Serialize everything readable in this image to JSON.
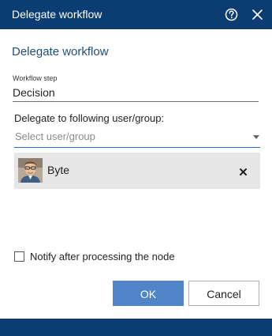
{
  "window": {
    "title": "Delegate workflow",
    "help_icon": "help-circle-icon",
    "close_icon": "close-icon"
  },
  "form": {
    "heading": "Delegate workflow",
    "workflow_step_label": "Workflow step",
    "workflow_step_value": "Decision",
    "delegate_label": "Delegate to following user/group:",
    "select_placeholder": "Select user/group",
    "selected_users": [
      {
        "name": "Byte",
        "avatar_icon": "user-avatar",
        "remove_icon": "remove-x-icon"
      }
    ],
    "notify_label": "Notify after processing the node",
    "notify_checked": false
  },
  "buttons": {
    "ok_label": "OK",
    "cancel_label": "Cancel"
  },
  "colors": {
    "titlebar": "#0c3d72",
    "heading": "#1f4e79",
    "primary_button": "#4f85c8",
    "chip_background": "#e6e6e6",
    "select_underline": "#2a6ac0"
  }
}
